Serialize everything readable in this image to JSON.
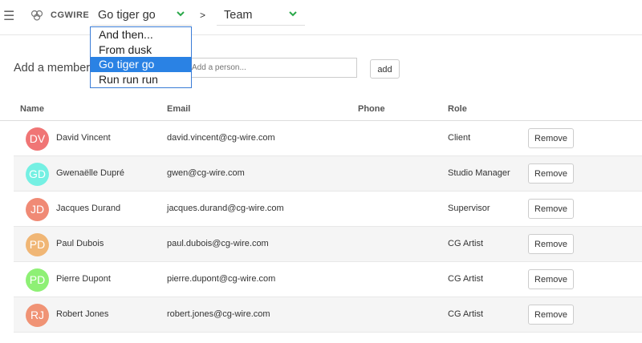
{
  "header": {
    "logo_text": "CGWIRE",
    "production": "Go tiger go",
    "separator": ">",
    "section": "Team"
  },
  "dropdown": {
    "options": [
      "And then...",
      "From dusk",
      "Go tiger go",
      "Run run run"
    ],
    "selected": "Go tiger go"
  },
  "add_member": {
    "label": "Add a member",
    "placeholder": "Add a person...",
    "button": "add"
  },
  "table": {
    "columns": [
      "Name",
      "Email",
      "Phone",
      "Role"
    ],
    "remove_label": "Remove",
    "rows": [
      {
        "initials": "DV",
        "color": "#f07575",
        "name": "David Vincent",
        "email": "david.vincent@cg-wire.com",
        "phone": "",
        "role": "Client"
      },
      {
        "initials": "GD",
        "color": "#75f0e3",
        "name": "Gwenaëlle Dupré",
        "email": "gwen@cg-wire.com",
        "phone": "",
        "role": "Studio Manager"
      },
      {
        "initials": "JD",
        "color": "#f08a75",
        "name": "Jacques Durand",
        "email": "jacques.durand@cg-wire.com",
        "phone": "",
        "role": "Supervisor"
      },
      {
        "initials": "PD",
        "color": "#f0b675",
        "name": "Paul Dubois",
        "email": "paul.dubois@cg-wire.com",
        "phone": "",
        "role": "CG Artist"
      },
      {
        "initials": "PD",
        "color": "#8ef075",
        "name": "Pierre Dupont",
        "email": "pierre.dupont@cg-wire.com",
        "phone": "",
        "role": "CG Artist"
      },
      {
        "initials": "RJ",
        "color": "#f09375",
        "name": "Robert Jones",
        "email": "robert.jones@cg-wire.com",
        "phone": "",
        "role": "CG Artist"
      }
    ]
  }
}
